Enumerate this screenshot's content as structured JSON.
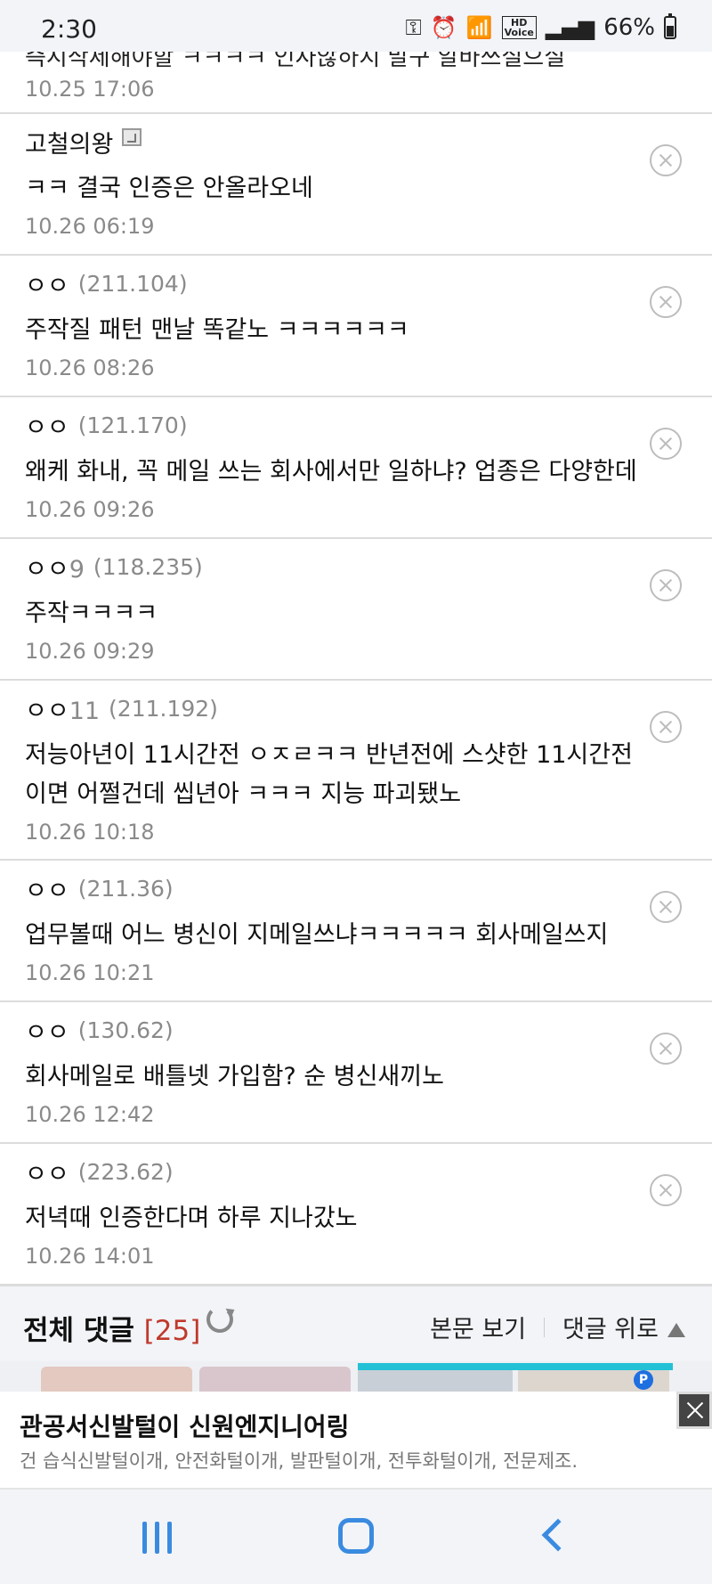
{
  "status_bar": {
    "time": "2:30",
    "hd_label": "HD",
    "voice_label": "Voice",
    "battery_percent": "66%"
  },
  "partial_comment": {
    "text": "즉시삭제해야할 ㅋㅋㅋㅋ 인사않하지 말구 알바쓰실으실",
    "date": "10.25 17:06"
  },
  "comments": [
    {
      "nick": "고철의왕",
      "ip": "",
      "text": "ㅋㅋ 결국 인증은 안올라오네",
      "date": "10.26 06:19",
      "has_badge": true
    },
    {
      "nick": "ㅇㅇ",
      "ip": "(211.104)",
      "text": "주작질 패턴 맨날 똑같노 ㅋㅋㅋㅋㅋㅋ",
      "date": "10.26 08:26"
    },
    {
      "nick": "ㅇㅇ",
      "ip": "(121.170)",
      "text": "왜케 화내, 꼭 메일 쓰는 회사에서만 일하냐? 업종은 다양한데",
      "date": "10.26 09:26"
    },
    {
      "nick": "ㅇㅇ",
      "num": "9",
      "ip": "(118.235)",
      "text": "주작ㅋㅋㅋㅋ",
      "date": "10.26 09:29"
    },
    {
      "nick": "ㅇㅇ",
      "num": "11",
      "ip": "(211.192)",
      "text": "저능아년이 11시간전 ㅇㅈㄹㅋㅋ 반년전에 스샷한 11시간전이면 어쩔건데 씹년아 ㅋㅋㅋ 지능 파괴됐노",
      "date": "10.26 10:18"
    },
    {
      "nick": "ㅇㅇ",
      "ip": "(211.36)",
      "text": "업무볼때 어느 병신이 지메일쓰냐ㅋㅋㅋㅋㅋ 회사메일쓰지",
      "date": "10.26 10:21"
    },
    {
      "nick": "ㅇㅇ",
      "ip": "(130.62)",
      "text": "회사메일로 배틀넷 가입함? 순 병신새끼노",
      "date": "10.26 12:42"
    },
    {
      "nick": "ㅇㅇ",
      "ip": "(223.62)",
      "text": "저녁때 인증한다며 하루 지나갔노",
      "date": "10.26 14:01"
    }
  ],
  "footer_bar": {
    "title": "전체 댓글",
    "count": "[25]",
    "view_post": "본문 보기",
    "comments_top": "댓글 위로"
  },
  "ad": {
    "title": "관공서신발털이 신원엔지니어링",
    "description": "건 습식신발털이개, 안전화털이개, 발판털이개, 전투화털이개, 전문제조.",
    "badge": "P"
  }
}
